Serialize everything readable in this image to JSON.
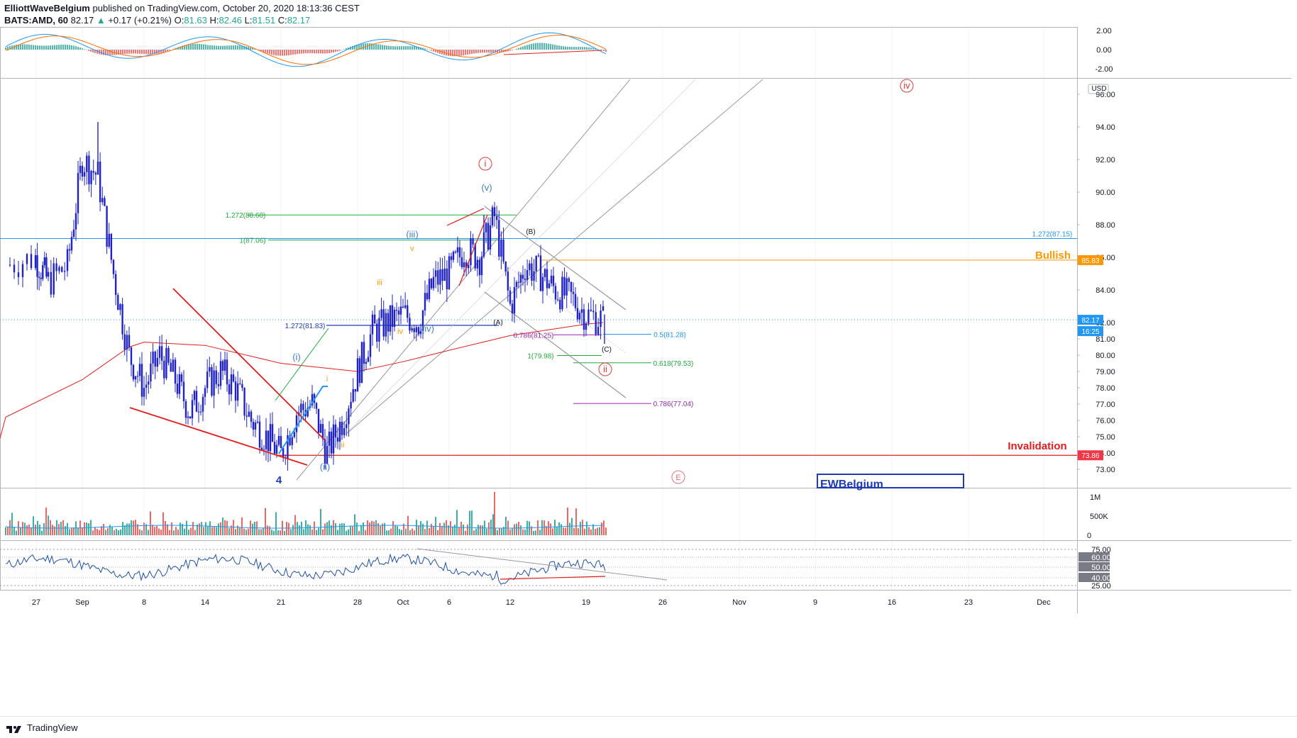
{
  "header": {
    "publisher": "ElliottWaveBelgium",
    "published_text": "published on TradingView.com, October 20, 2020 18:13:36 CEST",
    "symbol": "BATS:AMD, 60",
    "last": "82.17",
    "change": "+0.17 (+0.21%)",
    "o_label": "O:",
    "o": "81.63",
    "h_label": "H:",
    "h": "82.46",
    "l_label": "L:",
    "l": "81.51",
    "c_label": "C:",
    "c": "82.17"
  },
  "footer": {
    "brand": "TradingView"
  },
  "chart_data": {
    "type": "line",
    "title": "",
    "currency": "USD",
    "price_axis": [
      "96.00",
      "94.00",
      "92.00",
      "90.00",
      "88.00",
      "86.00",
      "84.00",
      "82.00",
      "81.00",
      "80.00",
      "79.00",
      "78.00",
      "77.00",
      "76.00",
      "75.00",
      "74.00",
      "73.00"
    ],
    "price_levels": [
      96,
      94,
      92,
      90,
      88,
      86,
      84,
      82,
      81,
      80,
      79,
      78,
      77,
      76,
      75,
      74,
      73
    ],
    "macd_axis": [
      "2.00",
      "0.00",
      "-2.00"
    ],
    "volume_axis": [
      "1M",
      "500K",
      "0"
    ],
    "rsi_axis": [
      "75.00",
      "60.00",
      "50.00",
      "40.00",
      "25.00"
    ],
    "x_ticks": [
      "27",
      "Sep",
      "8",
      "14",
      "21",
      "28",
      "Oct",
      "6",
      "12",
      "19",
      "26",
      "Nov",
      "9",
      "16",
      "23",
      "Dec"
    ],
    "price_tags": [
      {
        "label": "85.83",
        "color": "#ff9800"
      },
      {
        "label": "82.17",
        "color": "#2196f3"
      },
      {
        "label": "16:25",
        "color": "#2196f3"
      },
      {
        "label": "73.86",
        "color": "#f23645"
      }
    ],
    "fib_labels": [
      {
        "text": "1.272(88.60)",
        "color": "#22ab3c"
      },
      {
        "text": "1(87.06)",
        "color": "#22ab3c"
      },
      {
        "text": "1.272(87.15)",
        "color": "#2196f3"
      },
      {
        "text": "1.272(81.83)",
        "color": "#1e3bb3"
      },
      {
        "text": "0.786(81.25)",
        "color": "#9c27b0"
      },
      {
        "text": "0.5(81.28)",
        "color": "#2196f3"
      },
      {
        "text": "1(79.98)",
        "color": "#22ab3c"
      },
      {
        "text": "0.618(79.53)",
        "color": "#22ab3c"
      },
      {
        "text": "0.786(77.04)",
        "color": "#9c27b0"
      }
    ],
    "wave_labels": [
      {
        "text": "i",
        "color": "#e53935",
        "circled": true
      },
      {
        "text": "ii",
        "color": "#e53935",
        "circled": true
      },
      {
        "text": "iv",
        "color": "#e53935",
        "circled": true
      },
      {
        "text": "E",
        "color": "#e57373",
        "circled": true
      },
      {
        "text": "(v)",
        "color": "#3f7fd0"
      },
      {
        "text": "(iii)",
        "color": "#3f7fd0"
      },
      {
        "text": "(iv)",
        "color": "#3f7fd0"
      },
      {
        "text": "(i)",
        "color": "#3f7fd0"
      },
      {
        "text": "(ii)",
        "color": "#3f7fd0"
      },
      {
        "text": "v",
        "color": "#ff9800"
      },
      {
        "text": "iii",
        "color": "#ff9800"
      },
      {
        "text": "iv",
        "color": "#ff9800"
      },
      {
        "text": "i",
        "color": "#ff9800"
      },
      {
        "text": "ii",
        "color": "#ff9800"
      },
      {
        "text": "4",
        "color": "#1e3bb3"
      },
      {
        "text": "(B)",
        "color": "#131722"
      },
      {
        "text": "(A)",
        "color": "#131722"
      },
      {
        "text": "(C)",
        "color": "#131722"
      }
    ],
    "annotations": [
      {
        "text": "Bullish",
        "color": "#ff9800"
      },
      {
        "text": "Invalidation",
        "color": "#e31c1c"
      },
      {
        "text": "EWBelgium",
        "color": "#1e3bb3"
      }
    ],
    "price_series_hourly_close_approx": [
      {
        "date": "Aug 26",
        "close": 85.5
      },
      {
        "date": "Aug 27",
        "close": 86.0
      },
      {
        "date": "Aug 28",
        "close": 84.5
      },
      {
        "date": "Aug 31",
        "close": 85.5
      },
      {
        "date": "Sep 1",
        "close": 92.0
      },
      {
        "date": "Sep 2",
        "close": 91.0
      },
      {
        "date": "Sep 3",
        "close": 85.0
      },
      {
        "date": "Sep 4",
        "close": 80.0
      },
      {
        "date": "Sep 8",
        "close": 78.0
      },
      {
        "date": "Sep 9",
        "close": 80.0
      },
      {
        "date": "Sep 10",
        "close": 78.5
      },
      {
        "date": "Sep 11",
        "close": 76.5
      },
      {
        "date": "Sep 14",
        "close": 78.0
      },
      {
        "date": "Sep 15",
        "close": 79.0
      },
      {
        "date": "Sep 16",
        "close": 78.0
      },
      {
        "date": "Sep 17",
        "close": 76.0
      },
      {
        "date": "Sep 18",
        "close": 75.0
      },
      {
        "date": "Sep 21",
        "close": 73.9
      },
      {
        "date": "Sep 22",
        "close": 76.5
      },
      {
        "date": "Sep 23",
        "close": 77.0
      },
      {
        "date": "Sep 24",
        "close": 74.0
      },
      {
        "date": "Sep 25",
        "close": 76.0
      },
      {
        "date": "Sep 28",
        "close": 79.0
      },
      {
        "date": "Sep 29",
        "close": 81.5
      },
      {
        "date": "Sep 30",
        "close": 82.0
      },
      {
        "date": "Oct 1",
        "close": 82.5
      },
      {
        "date": "Oct 2",
        "close": 82.0
      },
      {
        "date": "Oct 5",
        "close": 84.5
      },
      {
        "date": "Oct 6",
        "close": 85.0
      },
      {
        "date": "Oct 7",
        "close": 86.5
      },
      {
        "date": "Oct 8",
        "close": 86.0
      },
      {
        "date": "Oct 9",
        "close": 88.5
      },
      {
        "date": "Oct 12",
        "close": 83.0
      },
      {
        "date": "Oct 13",
        "close": 85.5
      },
      {
        "date": "Oct 14",
        "close": 85.0
      },
      {
        "date": "Oct 15",
        "close": 84.0
      },
      {
        "date": "Oct 16",
        "close": 83.5
      },
      {
        "date": "Oct 19",
        "close": 82.5
      },
      {
        "date": "Oct 20",
        "close": 82.17
      }
    ],
    "ema_series_approx": [
      {
        "date": "Aug 26",
        "value": 76.2
      },
      {
        "date": "Sep 1",
        "value": 78.5
      },
      {
        "date": "Sep 4",
        "value": 80.5
      },
      {
        "date": "Sep 8",
        "value": 80.8
      },
      {
        "date": "Sep 14",
        "value": 80.6
      },
      {
        "date": "Sep 21",
        "value": 79.5
      },
      {
        "date": "Sep 28",
        "value": 79.0
      },
      {
        "date": "Oct 1",
        "value": 79.6
      },
      {
        "date": "Oct 6",
        "value": 80.3
      },
      {
        "date": "Oct 12",
        "value": 81.2
      },
      {
        "date": "Oct 19",
        "value": 81.9
      },
      {
        "date": "Oct 20",
        "value": 82.0
      }
    ]
  }
}
